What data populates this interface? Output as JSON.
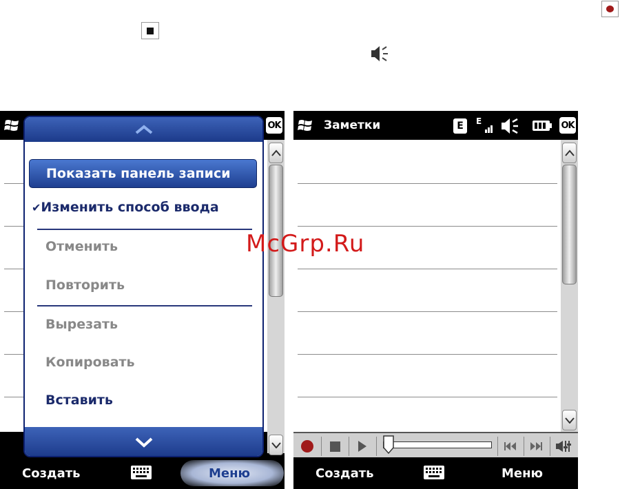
{
  "legend_icons": {
    "record": "record-icon",
    "stop": "stop-icon",
    "speaker": "speaker-icon"
  },
  "left_screen": {
    "ok_label": "OK",
    "menu": {
      "highlighted": "Показать панель записи",
      "items": [
        {
          "label": "Изменить способ ввода",
          "checked": true,
          "enabled": true
        },
        {
          "label": "Отменить",
          "enabled": false
        },
        {
          "label": "Повторить",
          "enabled": false
        },
        {
          "label": "Вырезать",
          "enabled": false
        },
        {
          "label": "Копировать",
          "enabled": false
        },
        {
          "label": "Вставить",
          "enabled": true
        }
      ],
      "check_mark": "✔"
    },
    "softkeys": {
      "left": "Создать",
      "right": "Меню"
    }
  },
  "right_screen": {
    "title": "Заметки",
    "ok_label": "OK",
    "status": {
      "e1": "E",
      "e2": "E"
    },
    "softkeys": {
      "left": "Создать",
      "right": "Меню"
    }
  },
  "watermark": "McGrp.Ru",
  "colors": {
    "menu_blue": "#1e3f90",
    "record_red": "#a01a1a",
    "watermark_red": "#d31a1a"
  }
}
